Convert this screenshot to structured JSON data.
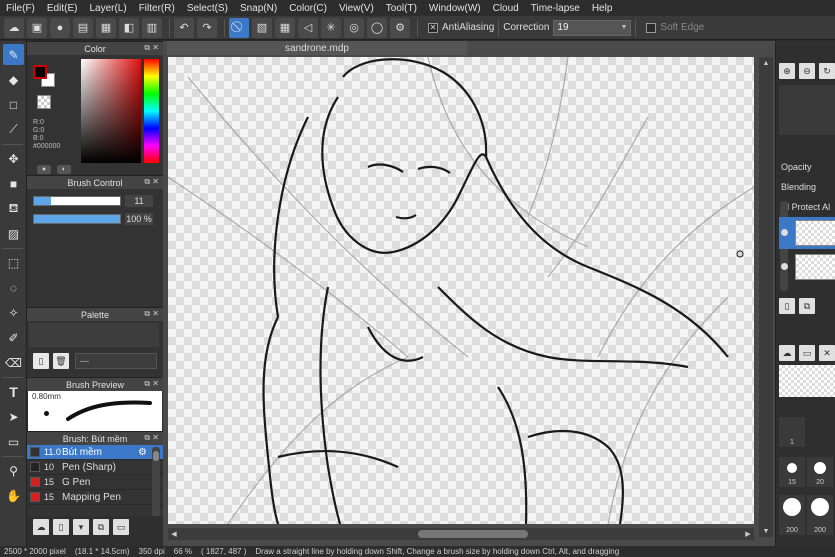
{
  "menu": [
    "File(F)",
    "Edit(E)",
    "Layer(L)",
    "Filter(R)",
    "Select(S)",
    "Snap(N)",
    "Color(C)",
    "View(V)",
    "Tool(T)",
    "Window(W)",
    "Cloud",
    "Time-lapse",
    "Help"
  ],
  "toolbar": {
    "antialiasing_label": "AntiAliasing",
    "correction_label": "Correction",
    "correction_value": "19",
    "soft_edge_label": "Soft Edge"
  },
  "panels": {
    "color": {
      "title": "Color",
      "r": "R:0",
      "g": "G:0",
      "b": "B:0",
      "hex": "#000000",
      "fg": "#000000",
      "bg": "#ffffff",
      "sv_hue": "#e01010"
    },
    "brush_control": {
      "title": "Brush Control",
      "size": "11",
      "size_fraction": 0.2,
      "opacity": "100 %",
      "opacity_fraction": 1.0
    },
    "palette": {
      "title": "Palette",
      "select_value": "---"
    },
    "brush_preview": {
      "title": "Brush Preview",
      "size_label": "0.80mm"
    },
    "brush_list": {
      "title": "Brush: Bút mềm",
      "items": [
        {
          "num": "11.0",
          "name": "Bút mềm",
          "color": "#333333",
          "selected": true
        },
        {
          "num": "10",
          "name": "Pen (Sharp)",
          "color": "#222222",
          "selected": false
        },
        {
          "num": "15",
          "name": "G Pen",
          "color": "#d42020",
          "selected": false
        },
        {
          "num": "15",
          "name": "Mapping Pen",
          "color": "#d42020",
          "selected": false
        }
      ]
    }
  },
  "document": {
    "tab_title": "sandrone.mdp"
  },
  "right_panel": {
    "opacity_label": "Opacity",
    "blending_label": "Blending",
    "protect_alpha_label": "Protect Al",
    "brush_sizes": [
      "1",
      "15",
      "15",
      "20",
      "200",
      "200"
    ]
  },
  "status": {
    "size": "2500 * 2000 pixel",
    "physical": "(18.1 * 14.5cm)",
    "dpi": "350 dpi",
    "zoom": "66 %",
    "cursor": "( 1827, 487 )",
    "hint": "Draw a straight line by holding down Shift, Change a brush size by holding down Ctrl, Alt, and dragging"
  },
  "colors": {
    "accent": "#3b78c8",
    "panel_bg": "#2f2f2f",
    "menu_bg": "#2d2d2d"
  }
}
